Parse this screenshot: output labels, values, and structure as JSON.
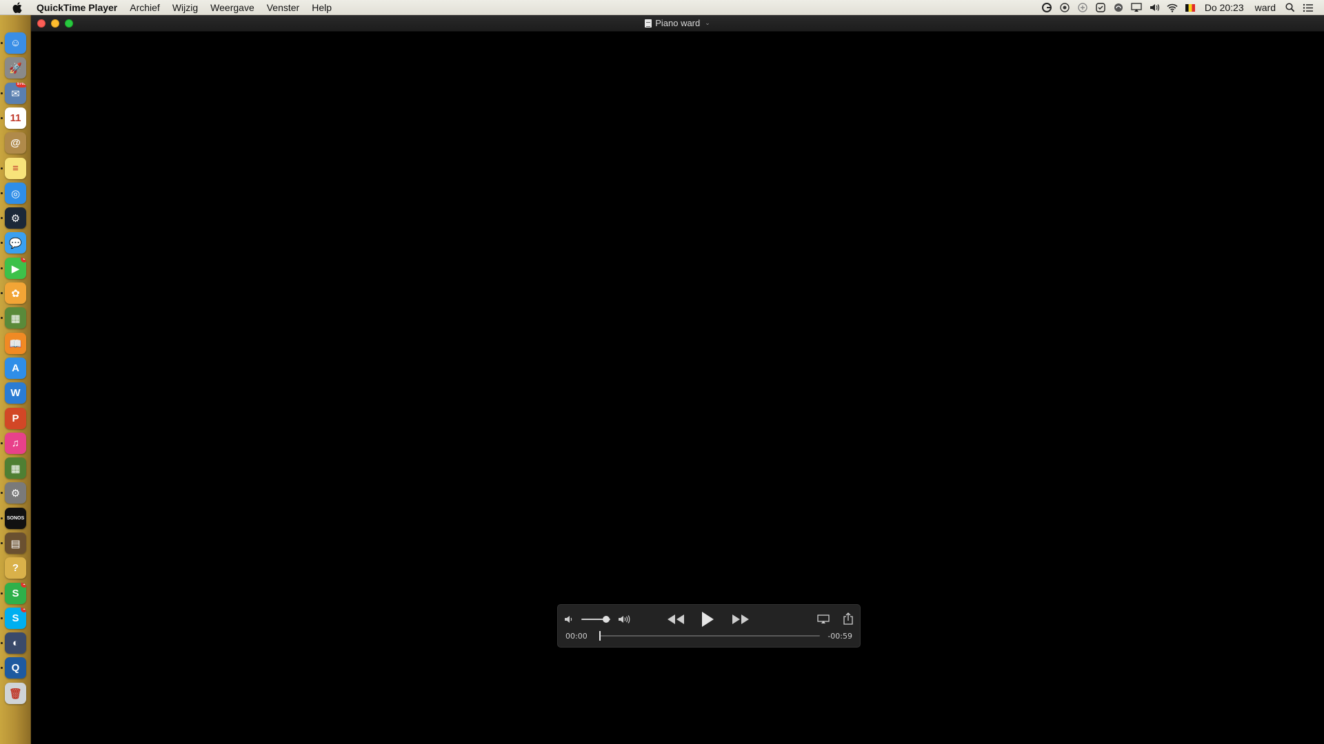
{
  "menubar": {
    "apple_icon": "apple-logo-icon",
    "app_name": "QuickTime Player",
    "items": [
      "Archief",
      "Wijzig",
      "Weergave",
      "Venster",
      "Help"
    ],
    "clock": "Do 20:23",
    "user": "ward",
    "status_icons": [
      "grammarly-icon",
      "status-icon-2",
      "status-icon-3",
      "checkmark-circle-icon",
      "sync-icon",
      "airplay-icon",
      "volume-icon",
      "wifi-icon",
      "flag-icon",
      "search-icon",
      "notification-list-icon"
    ]
  },
  "dock": {
    "items": [
      {
        "name": "finder",
        "glyph": "☺",
        "color": "#3a8ee6",
        "running": true
      },
      {
        "name": "launchpad",
        "glyph": "🚀",
        "color": "#8a8a8a",
        "running": false
      },
      {
        "name": "mail",
        "glyph": "✉",
        "color": "#5a7fb0",
        "running": true,
        "badge": "5765"
      },
      {
        "name": "calendar",
        "glyph": "11",
        "color": "#ffffff",
        "running": true
      },
      {
        "name": "contacts",
        "glyph": "@",
        "color": "#b08a4a",
        "running": false
      },
      {
        "name": "notes",
        "glyph": "≡",
        "color": "#f7e37a",
        "running": true
      },
      {
        "name": "safari",
        "glyph": "◎",
        "color": "#2f8ee8",
        "running": true
      },
      {
        "name": "steam",
        "glyph": "⚙",
        "color": "#1b2838",
        "running": true
      },
      {
        "name": "messages",
        "glyph": "💬",
        "color": "#3aa0f0",
        "running": true
      },
      {
        "name": "facetime",
        "glyph": "▶",
        "color": "#3dc14a",
        "running": true,
        "badge": "8"
      },
      {
        "name": "photos",
        "glyph": "✿",
        "color": "#f2a536",
        "running": true
      },
      {
        "name": "minecraft",
        "glyph": "▦",
        "color": "#5a8a3a",
        "running": true
      },
      {
        "name": "ibooks",
        "glyph": "📖",
        "color": "#f08a24",
        "running": false
      },
      {
        "name": "app-store",
        "glyph": "A",
        "color": "#2f8ee8",
        "running": false
      },
      {
        "name": "word",
        "glyph": "W",
        "color": "#2b7cd3",
        "running": false
      },
      {
        "name": "powerpoint",
        "glyph": "P",
        "color": "#d24726",
        "running": false
      },
      {
        "name": "itunes",
        "glyph": "♫",
        "color": "#e8418a",
        "running": true
      },
      {
        "name": "minecraft-2",
        "glyph": "▦",
        "color": "#4f7f33",
        "running": false
      },
      {
        "name": "system-preferences",
        "glyph": "⚙",
        "color": "#7a7a7a",
        "running": true
      },
      {
        "name": "sonos",
        "glyph": "SONOS",
        "color": "#111111",
        "running": true
      },
      {
        "name": "box-app",
        "glyph": "▤",
        "color": "#6a5030",
        "running": true
      },
      {
        "name": "help",
        "glyph": "?",
        "color": "#d9b14a",
        "running": false
      },
      {
        "name": "slack-like",
        "glyph": "S",
        "color": "#2fb04a",
        "running": true,
        "badge": "1"
      },
      {
        "name": "skype",
        "glyph": "S",
        "color": "#00aff0",
        "running": true,
        "badge": "1"
      },
      {
        "name": "dj-app",
        "glyph": "◐",
        "color": "#3a4a6a",
        "running": true
      },
      {
        "name": "quicktime",
        "glyph": "Q",
        "color": "#1e5aa0",
        "running": true
      },
      {
        "name": "trash",
        "glyph": "🗑",
        "color": "#cfd3d6",
        "running": false
      }
    ]
  },
  "window": {
    "title": "Piano ward",
    "title_icon": "document-icon"
  },
  "player": {
    "elapsed": "00:00",
    "remaining": "-00:59",
    "progress": 0.0,
    "volume": 0.85,
    "buttons": {
      "volume_low": "volume-low-icon",
      "volume_high": "volume-high-icon",
      "rewind": "rewind-icon",
      "play": "play-icon",
      "fast_forward": "fast-forward-icon",
      "airplay": "airplay-icon",
      "share": "share-icon"
    }
  },
  "colors": {
    "menubar_bg": "#e8e6dd",
    "window_bg": "#000000",
    "hud_bg": "#262626",
    "close": "#fc5f57",
    "minimize": "#fdbc2e",
    "maximize": "#28c840"
  }
}
